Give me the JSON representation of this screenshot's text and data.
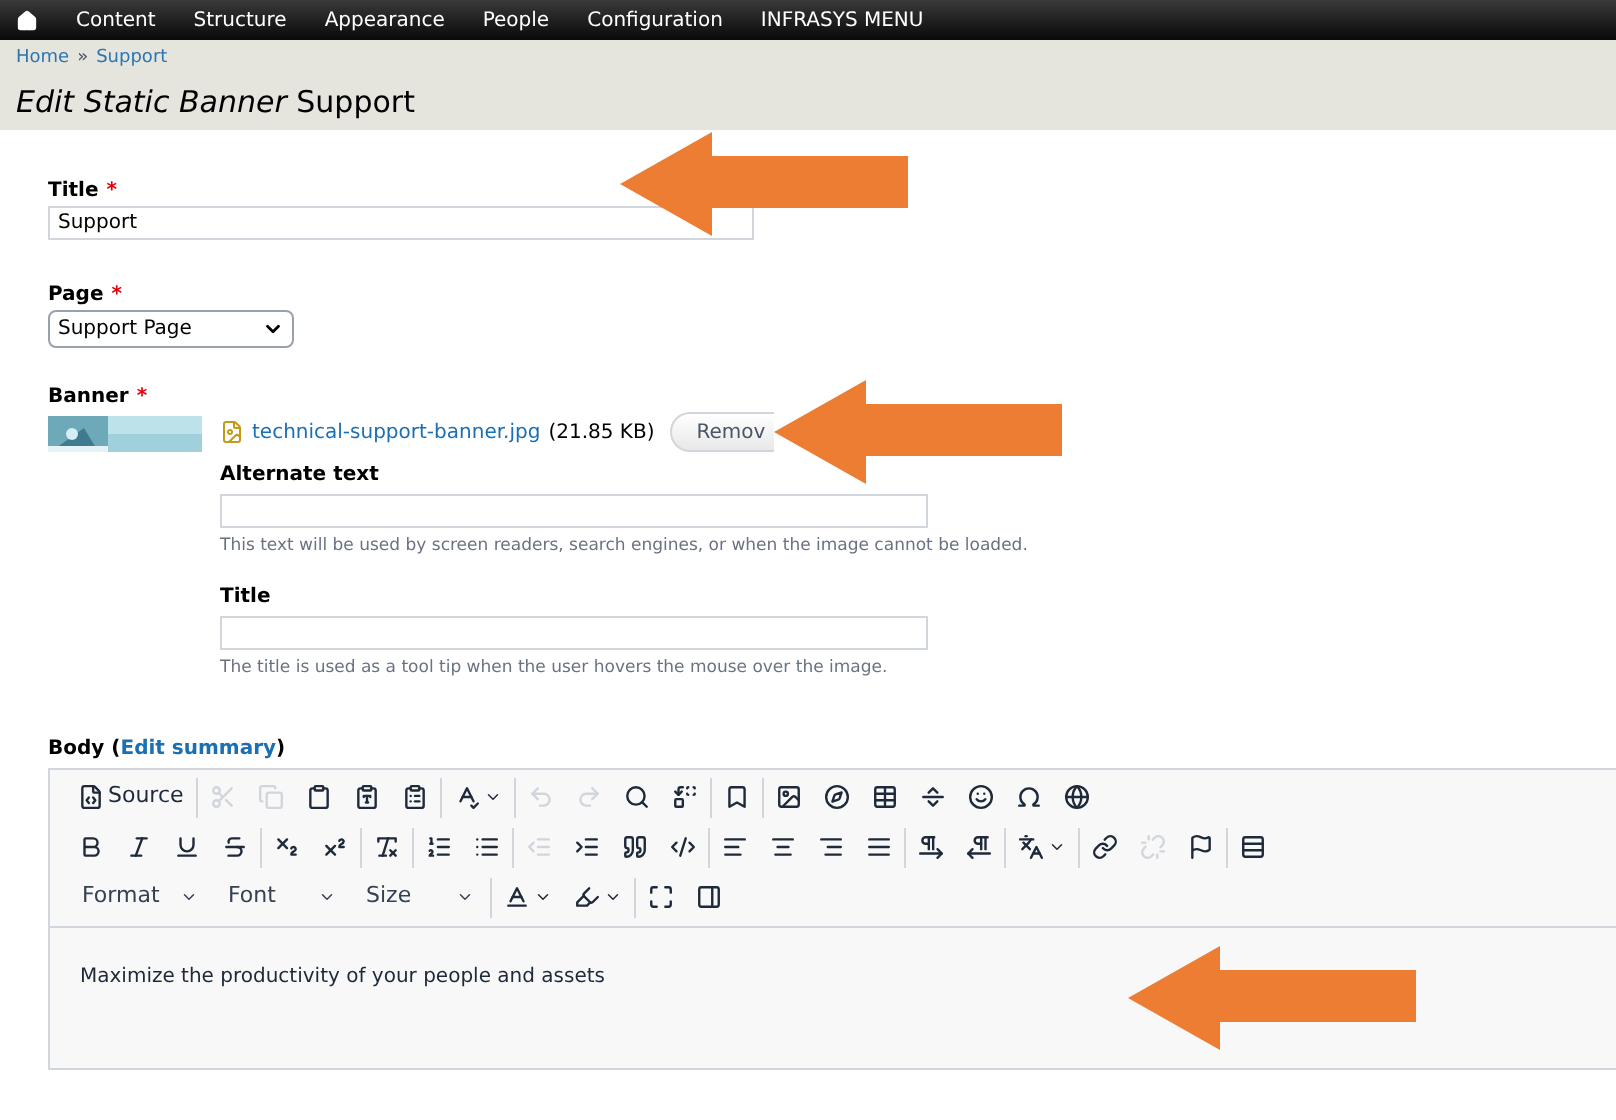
{
  "nav": {
    "items": [
      "Content",
      "Structure",
      "Appearance",
      "People",
      "Configuration",
      "INFRASYS MENU"
    ]
  },
  "breadcrumb": {
    "items": [
      "Home",
      "Support"
    ],
    "separator": "»"
  },
  "page_title": {
    "type_name": "Edit Static Banner",
    "node_title": "Support"
  },
  "form": {
    "title": {
      "label": "Title",
      "required_mark": "*",
      "value": "Support"
    },
    "page": {
      "label": "Page",
      "required_mark": "*",
      "value": "Support Page"
    },
    "banner": {
      "label": "Banner",
      "required_mark": "*",
      "file_name": "technical-support-banner.jpg",
      "file_size": "(21.85 KB)",
      "remove_button": "Remov",
      "alt": {
        "label": "Alternate text",
        "description": "This text will be used by screen readers, search engines, or when the image cannot be loaded."
      },
      "title": {
        "label": "Title",
        "description": "The title is used as a tool tip when the user hovers the mouse over the image."
      }
    },
    "body": {
      "label": "Body (",
      "link": "Edit summary",
      "label_end": ")",
      "text": "Maximize the productivity of your people and assets",
      "toolbar": [
        [
          [
            {
              "label": "Source",
              "disabled": false
            }
          ],
          [
            {
              "disabled": true
            },
            {
              "disabled": true
            },
            {
              "disabled": false
            },
            {
              "disabled": false
            },
            {
              "disabled": false
            }
          ],
          [
            {
              "disabled": false,
              "dropdown": true
            }
          ],
          [
            {
              "disabled": true
            },
            {
              "disabled": true
            },
            {
              "disabled": false
            },
            {
              "disabled": false
            }
          ],
          [
            {
              "disabled": false
            }
          ],
          [
            {
              "disabled": false
            },
            {
              "disabled": false
            },
            {
              "disabled": false
            },
            {
              "disabled": false
            },
            {
              "disabled": false
            },
            {
              "disabled": false
            },
            {
              "disabled": false
            }
          ]
        ],
        [
          [
            {
              "disabled": false
            },
            {
              "disabled": false
            },
            {
              "disabled": false
            },
            {
              "disabled": false
            }
          ],
          [
            {
              "disabled": false
            },
            {
              "disabled": false
            }
          ],
          [
            {
              "disabled": false
            }
          ],
          [
            {
              "disabled": false
            },
            {
              "disabled": false
            }
          ],
          [
            {
              "disabled": true
            },
            {
              "disabled": false
            },
            {
              "disabled": false
            },
            {
              "disabled": false
            }
          ],
          [
            {
              "disabled": false
            },
            {
              "disabled": false
            },
            {
              "disabled": false
            },
            {
              "disabled": false
            }
          ],
          [
            {
              "disabled": false
            },
            {
              "disabled": false
            }
          ],
          [
            {
              "disabled": false,
              "dropdown": true
            }
          ],
          [
            {
              "disabled": false
            },
            {
              "disabled": true
            },
            {
              "disabled": false
            }
          ],
          [
            {
              "disabled": false
            }
          ]
        ],
        [
          [
            {
              "kind": "combo",
              "label": "Format"
            },
            {
              "kind": "combo",
              "label": "Font"
            },
            {
              "kind": "combo",
              "label": "Size"
            }
          ],
          [
            {
              "disabled": false,
              "dropdown": true
            },
            {
              "disabled": false,
              "dropdown": true
            }
          ],
          [
            {
              "disabled": false
            },
            {
              "disabled": false
            }
          ]
        ]
      ]
    }
  }
}
